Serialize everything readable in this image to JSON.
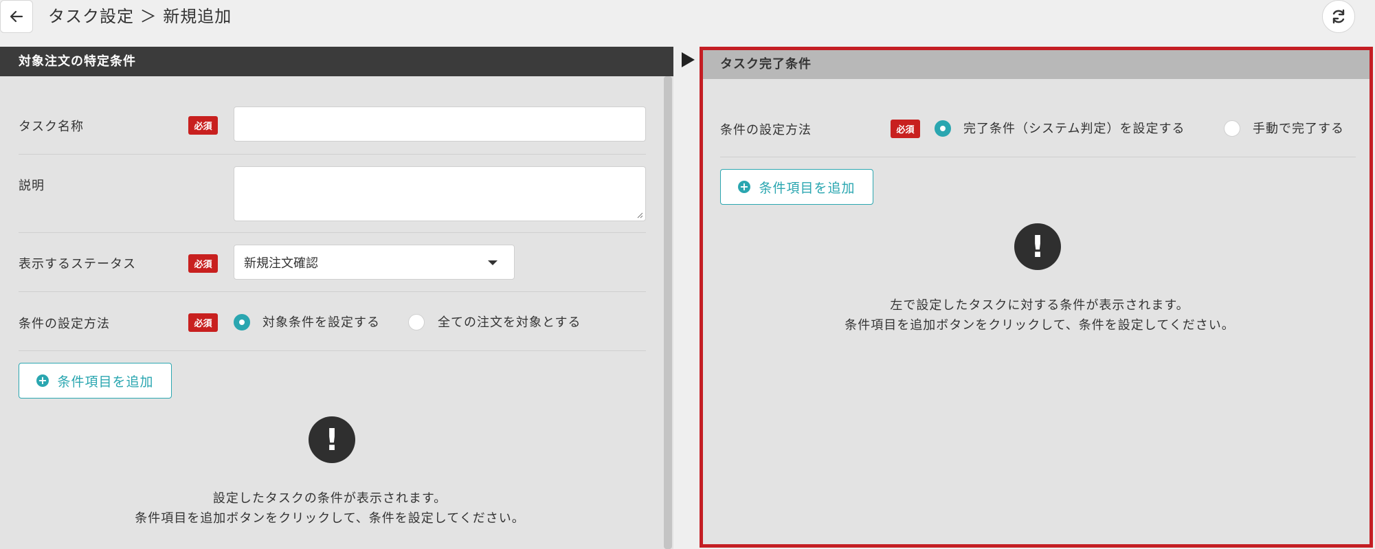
{
  "header": {
    "title": "タスク設定 ＞ 新規追加"
  },
  "left": {
    "section_title": "対象注文の特定条件",
    "required_label": "必須",
    "task_name_label": "タスク名称",
    "description_label": "説明",
    "status_label": "表示するステータス",
    "status_value": "新規注文確認",
    "condition_method_label": "条件の設定方法",
    "option_set_conditions": "対象条件を設定する",
    "option_all_orders": "全ての注文を対象とする",
    "add_condition_label": "条件項目を追加",
    "message_line1": "設定したタスクの条件が表示されます。",
    "message_line2": "条件項目を追加ボタンをクリックして、条件を設定してください。"
  },
  "right": {
    "section_title": "タスク完了条件",
    "required_label": "必須",
    "condition_method_label": "条件の設定方法",
    "option_system": "完了条件（システム判定）を設定する",
    "option_manual": "手動で完了する",
    "add_condition_label": "条件項目を追加",
    "message_line1": "左で設定したタスクに対する条件が表示されます。",
    "message_line2": "条件項目を追加ボタンをクリックして、条件を設定してください。"
  },
  "colors": {
    "accent": "#2aa6b0",
    "required": "#c8201f",
    "highlight_border": "#c41e24",
    "left_header_bg": "#3b3b3b",
    "right_header_bg": "#b8b8b8"
  }
}
